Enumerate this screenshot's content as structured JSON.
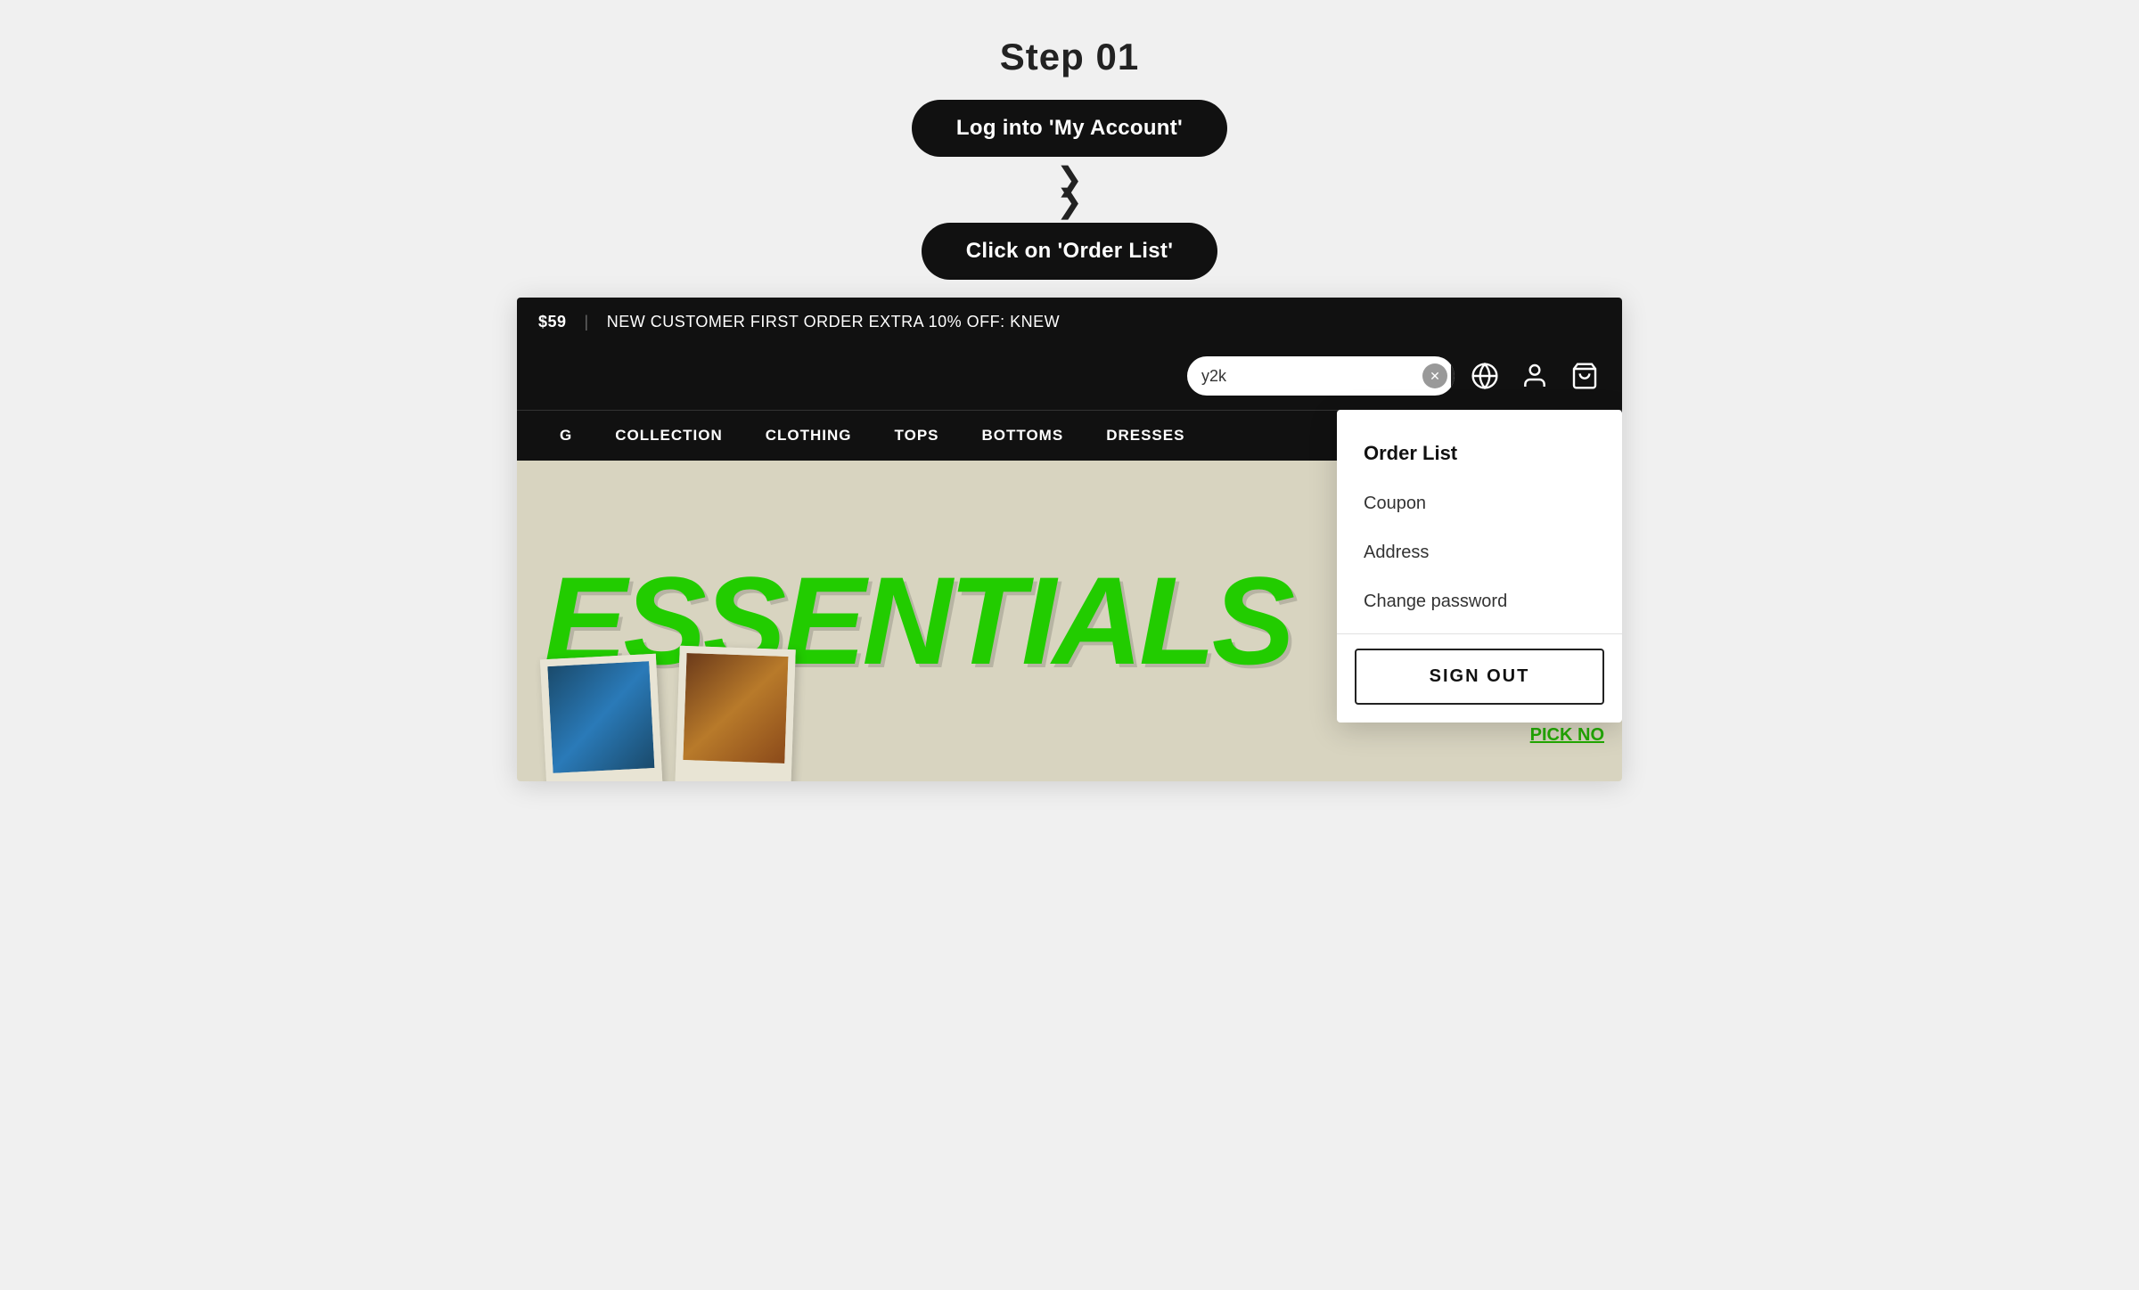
{
  "page": {
    "step_title": "Step 01",
    "button_login": "Log into 'My Account'",
    "button_order_list": "Click on 'Order List'"
  },
  "announcement": {
    "price": "$59",
    "divider": "|",
    "message": "NEW CUSTOMER FIRST ORDER EXTRA 10% OFF: KNEW"
  },
  "search": {
    "value": "y2k",
    "placeholder": "Search"
  },
  "nav": {
    "items": [
      {
        "label": "G"
      },
      {
        "label": "COLLECTION"
      },
      {
        "label": "CLOTHING"
      },
      {
        "label": "TOPS"
      },
      {
        "label": "BOTTOMS"
      },
      {
        "label": "DRESSES"
      }
    ]
  },
  "dropdown": {
    "items": [
      {
        "label": "Order List",
        "active": true
      },
      {
        "label": "Coupon",
        "active": false
      },
      {
        "label": "Address",
        "active": false
      },
      {
        "label": "Change password",
        "active": false
      }
    ],
    "sign_out": "SIGN OUT"
  },
  "hero": {
    "text": "ESSENTIALS",
    "pick_now": "PICK NO"
  },
  "icons": {
    "search": "search-icon",
    "clear": "clear-icon",
    "globe": "globe-icon",
    "user": "user-icon",
    "cart": "cart-icon"
  },
  "chevron": {
    "symbol": "❯❯"
  }
}
